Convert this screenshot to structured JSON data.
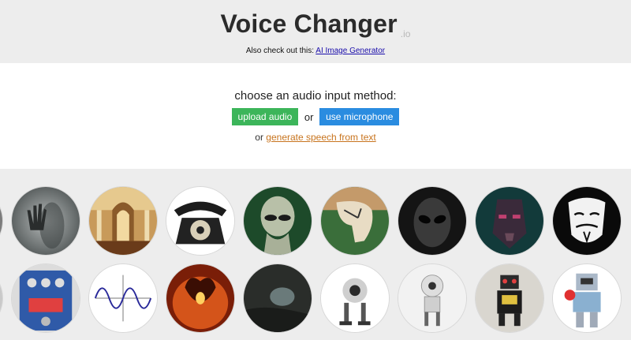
{
  "header": {
    "title": "Voice Changer",
    "suffix": ".io",
    "also_text": "Also check out this:",
    "also_link": "AI Image Generator"
  },
  "input": {
    "prompt": "choose an audio input method:",
    "upload_label": "upload audio",
    "or_text": "or",
    "mic_label": "use microphone",
    "gen_prefix": "or",
    "gen_link": "generate speech from text"
  },
  "gallery": {
    "row1": [
      "hand-behind-glass-icon",
      "cathedral-icon",
      "rotary-telephone-icon",
      "alien-icon",
      "melting-clock-icon",
      "grey-alien-icon",
      "cyborg-icon",
      "anonymous-mask-icon"
    ],
    "row2": [
      "guitar-pedal-icon",
      "sine-wave-icon",
      "balrog-icon",
      "cave-icon",
      "robot-walker-icon",
      "robot-white-icon",
      "robot-toy-icon",
      "robot-lego-icon"
    ]
  },
  "colors": {
    "upload_button": "#3cb55a",
    "mic_button": "#2a8ce0",
    "generate_link": "#c8741e",
    "also_link": "#1a0dab"
  }
}
